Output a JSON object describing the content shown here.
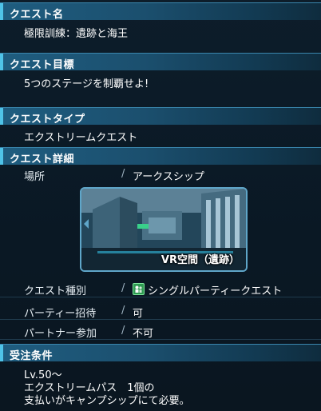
{
  "sections": {
    "quest_name": {
      "header": "クエスト名",
      "value": "極限訓練：遺跡と海王"
    },
    "quest_goal": {
      "header": "クエスト目標",
      "value": "5つのステージを制覇せよ!"
    },
    "quest_type": {
      "header": "クエストタイプ",
      "value": "エクストリームクエスト"
    },
    "quest_detail": {
      "header": "クエスト詳細",
      "location_label": "場所",
      "location_value": "アークスシップ",
      "thumbnail_caption": "VR空間（遺跡）",
      "rows": [
        {
          "label": "クエスト種別",
          "value": "シングルパーティークエスト",
          "icon": "single-party-icon"
        },
        {
          "label": "パーティー招待",
          "value": "可"
        },
        {
          "label": "パートナー参加",
          "value": "不可"
        }
      ],
      "separator": "/"
    },
    "requirements": {
      "header": "受注条件",
      "lines": [
        "Lv.50～",
        "エクストリームパス　1個の",
        "支払いがキャンプシップにて必要。"
      ]
    }
  },
  "colors": {
    "header_bg": "#1f5d80",
    "accent": "#4fc3e8",
    "panel_bg": "#0d1d2a",
    "icon_green": "#2f9a52"
  }
}
